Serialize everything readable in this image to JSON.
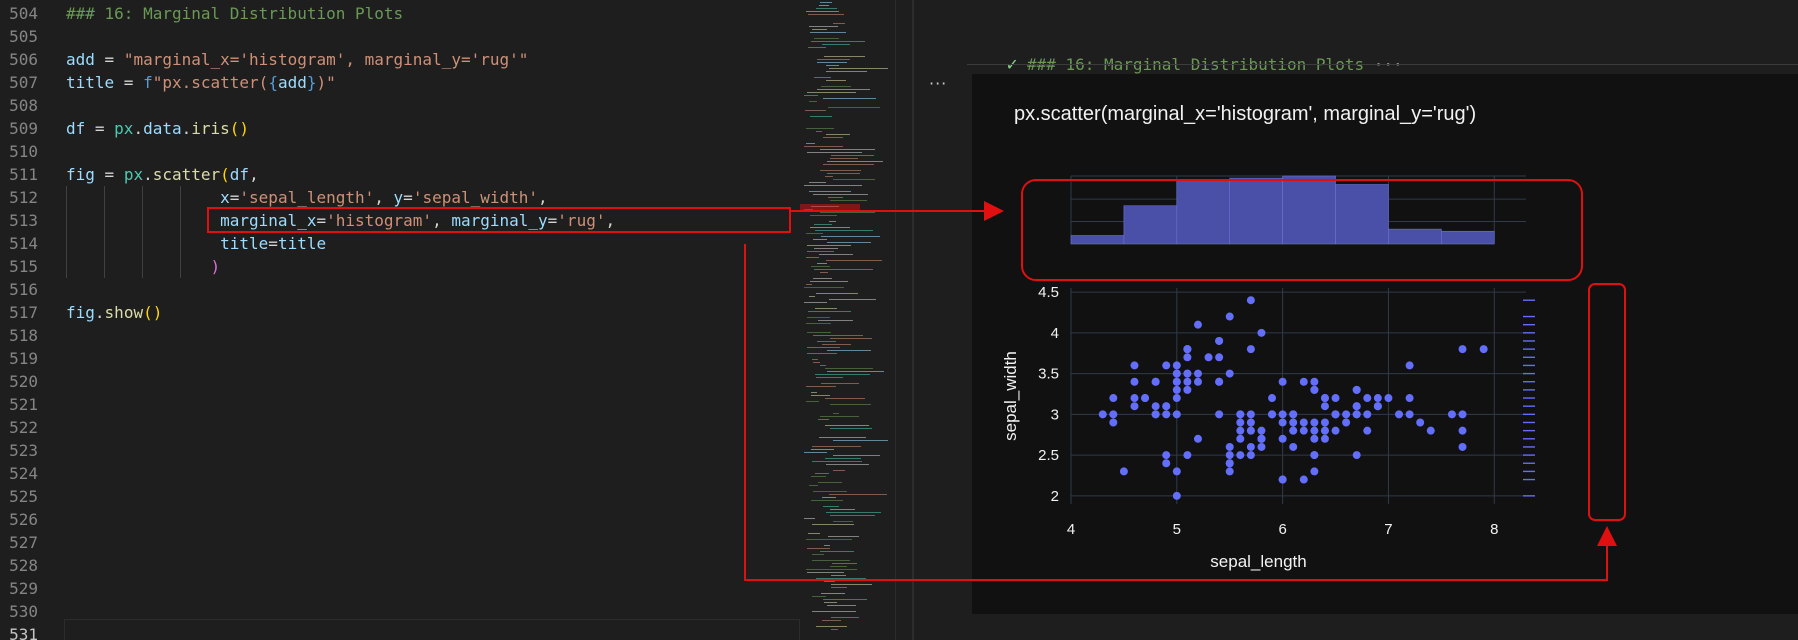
{
  "editor": {
    "lines": [
      {
        "num": "504",
        "tokens": [
          [
            "c",
            "### 16: Marginal Distribution Plots"
          ]
        ]
      },
      {
        "num": "505",
        "tokens": []
      },
      {
        "num": "506",
        "tokens": [
          [
            "v",
            "add"
          ],
          [
            "o",
            " = "
          ],
          [
            "s",
            "\"marginal_x='histogram', marginal_y='rug'\""
          ]
        ]
      },
      {
        "num": "507",
        "tokens": [
          [
            "v",
            "title"
          ],
          [
            "o",
            " = "
          ],
          [
            "f",
            "f"
          ],
          [
            "s",
            "\"px.scatter("
          ],
          [
            "f",
            "{"
          ],
          [
            "v",
            "add"
          ],
          [
            "f",
            "}"
          ],
          [
            "s",
            ")\""
          ]
        ]
      },
      {
        "num": "508",
        "tokens": []
      },
      {
        "num": "509",
        "tokens": [
          [
            "v",
            "df"
          ],
          [
            "o",
            " = "
          ],
          [
            "m",
            "px"
          ],
          [
            "o",
            "."
          ],
          [
            "v",
            "data"
          ],
          [
            "o",
            "."
          ],
          [
            "n",
            "iris"
          ],
          [
            "b",
            "()"
          ]
        ]
      },
      {
        "num": "510",
        "tokens": []
      },
      {
        "num": "511",
        "tokens": [
          [
            "v",
            "fig"
          ],
          [
            "o",
            " = "
          ],
          [
            "m",
            "px"
          ],
          [
            "o",
            "."
          ],
          [
            "n",
            "scatter"
          ],
          [
            "b",
            "("
          ],
          [
            "v",
            "df"
          ],
          [
            "o",
            ","
          ]
        ]
      },
      {
        "num": "512",
        "tokens": [
          [
            "o",
            "                "
          ],
          [
            "v",
            "x"
          ],
          [
            "o",
            "="
          ],
          [
            "s",
            "'sepal_length'"
          ],
          [
            "o",
            ", "
          ],
          [
            "v",
            "y"
          ],
          [
            "o",
            "="
          ],
          [
            "s",
            "'sepal_width'"
          ],
          [
            "o",
            ","
          ]
        ]
      },
      {
        "num": "513",
        "tokens": [
          [
            "o",
            "                "
          ],
          [
            "v",
            "marginal_x"
          ],
          [
            "o",
            "="
          ],
          [
            "s",
            "'histogram'"
          ],
          [
            "o",
            ", "
          ],
          [
            "v",
            "marginal_y"
          ],
          [
            "o",
            "="
          ],
          [
            "s",
            "'rug'"
          ],
          [
            "o",
            ","
          ]
        ]
      },
      {
        "num": "514",
        "tokens": [
          [
            "o",
            "                "
          ],
          [
            "v",
            "title"
          ],
          [
            "o",
            "="
          ],
          [
            "v",
            "title"
          ]
        ]
      },
      {
        "num": "515",
        "tokens": [
          [
            "o",
            "               "
          ],
          [
            "b",
            ")"
          ]
        ]
      },
      {
        "num": "516",
        "tokens": []
      },
      {
        "num": "517",
        "tokens": [
          [
            "v",
            "fig"
          ],
          [
            "o",
            "."
          ],
          [
            "n",
            "show"
          ],
          [
            "b",
            "()"
          ]
        ]
      },
      {
        "num": "518",
        "tokens": []
      },
      {
        "num": "519",
        "tokens": []
      },
      {
        "num": "520",
        "tokens": []
      },
      {
        "num": "521",
        "tokens": []
      },
      {
        "num": "522",
        "tokens": []
      },
      {
        "num": "523",
        "tokens": []
      },
      {
        "num": "524",
        "tokens": []
      },
      {
        "num": "525",
        "tokens": []
      },
      {
        "num": "526",
        "tokens": []
      },
      {
        "num": "527",
        "tokens": []
      },
      {
        "num": "528",
        "tokens": []
      },
      {
        "num": "529",
        "tokens": []
      },
      {
        "num": "530",
        "tokens": []
      },
      {
        "num": "531",
        "tokens": []
      }
    ],
    "active_line": "531"
  },
  "notebook": {
    "cell_header": "### 16: Marginal Distribution Plots",
    "cell_header_ellipsis": "···",
    "cell_menu": "···"
  },
  "chart_data": {
    "type": "scatter",
    "title": "px.scatter(marginal_x='histogram', marginal_y='rug')",
    "xlabel": "sepal_length",
    "ylabel": "sepal_width",
    "xlim": [
      4,
      8.3
    ],
    "ylim": [
      1.9,
      4.55
    ],
    "xticks": [
      "4",
      "5",
      "6",
      "7",
      "8"
    ],
    "yticks": [
      "2",
      "2.5",
      "3",
      "3.5",
      "4",
      "4.5"
    ],
    "marker_color": "#636efa",
    "points": [
      [
        5.1,
        3.5
      ],
      [
        4.9,
        3.0
      ],
      [
        4.7,
        3.2
      ],
      [
        4.6,
        3.1
      ],
      [
        5.0,
        3.6
      ],
      [
        5.4,
        3.9
      ],
      [
        4.6,
        3.4
      ],
      [
        5.0,
        3.4
      ],
      [
        4.4,
        2.9
      ],
      [
        4.9,
        3.1
      ],
      [
        5.4,
        3.7
      ],
      [
        4.8,
        3.4
      ],
      [
        4.8,
        3.0
      ],
      [
        4.3,
        3.0
      ],
      [
        5.8,
        4.0
      ],
      [
        5.7,
        4.4
      ],
      [
        5.4,
        3.9
      ],
      [
        5.1,
        3.5
      ],
      [
        5.7,
        3.8
      ],
      [
        5.1,
        3.8
      ],
      [
        5.4,
        3.4
      ],
      [
        5.1,
        3.7
      ],
      [
        4.6,
        3.6
      ],
      [
        5.1,
        3.3
      ],
      [
        4.8,
        3.4
      ],
      [
        5.0,
        3.0
      ],
      [
        5.0,
        3.4
      ],
      [
        5.2,
        3.5
      ],
      [
        5.2,
        3.4
      ],
      [
        4.7,
        3.2
      ],
      [
        4.8,
        3.1
      ],
      [
        5.4,
        3.4
      ],
      [
        5.2,
        4.1
      ],
      [
        5.5,
        4.2
      ],
      [
        4.9,
        3.1
      ],
      [
        5.0,
        3.2
      ],
      [
        5.5,
        3.5
      ],
      [
        4.9,
        3.6
      ],
      [
        4.4,
        3.0
      ],
      [
        5.1,
        3.4
      ],
      [
        5.0,
        3.5
      ],
      [
        4.5,
        2.3
      ],
      [
        4.4,
        3.2
      ],
      [
        5.0,
        3.5
      ],
      [
        5.1,
        3.8
      ],
      [
        4.8,
        3.0
      ],
      [
        5.1,
        3.8
      ],
      [
        4.6,
        3.2
      ],
      [
        5.3,
        3.7
      ],
      [
        5.0,
        3.3
      ],
      [
        7.0,
        3.2
      ],
      [
        6.4,
        3.2
      ],
      [
        6.9,
        3.1
      ],
      [
        5.5,
        2.3
      ],
      [
        6.5,
        2.8
      ],
      [
        5.7,
        2.8
      ],
      [
        6.3,
        3.3
      ],
      [
        4.9,
        2.4
      ],
      [
        6.6,
        2.9
      ],
      [
        5.2,
        2.7
      ],
      [
        5.0,
        2.0
      ],
      [
        5.9,
        3.0
      ],
      [
        6.0,
        2.2
      ],
      [
        6.1,
        2.9
      ],
      [
        5.6,
        2.9
      ],
      [
        6.7,
        3.1
      ],
      [
        5.6,
        3.0
      ],
      [
        5.8,
        2.7
      ],
      [
        6.2,
        2.2
      ],
      [
        5.6,
        2.5
      ],
      [
        5.9,
        3.2
      ],
      [
        6.1,
        2.8
      ],
      [
        6.3,
        2.5
      ],
      [
        6.1,
        2.8
      ],
      [
        6.4,
        2.9
      ],
      [
        6.6,
        3.0
      ],
      [
        6.8,
        2.8
      ],
      [
        6.7,
        3.0
      ],
      [
        6.0,
        2.9
      ],
      [
        5.7,
        2.6
      ],
      [
        5.5,
        2.4
      ],
      [
        5.5,
        2.4
      ],
      [
        5.8,
        2.7
      ],
      [
        6.0,
        2.7
      ],
      [
        5.4,
        3.0
      ],
      [
        6.0,
        3.4
      ],
      [
        6.7,
        3.1
      ],
      [
        6.3,
        2.3
      ],
      [
        5.6,
        3.0
      ],
      [
        5.5,
        2.5
      ],
      [
        5.5,
        2.6
      ],
      [
        6.1,
        3.0
      ],
      [
        5.8,
        2.6
      ],
      [
        5.0,
        2.3
      ],
      [
        5.6,
        2.7
      ],
      [
        5.7,
        3.0
      ],
      [
        5.7,
        2.9
      ],
      [
        6.2,
        2.9
      ],
      [
        5.1,
        2.5
      ],
      [
        5.7,
        2.8
      ],
      [
        6.3,
        3.3
      ],
      [
        5.8,
        2.7
      ],
      [
        7.1,
        3.0
      ],
      [
        6.3,
        2.9
      ],
      [
        6.5,
        3.0
      ],
      [
        7.6,
        3.0
      ],
      [
        4.9,
        2.5
      ],
      [
        7.3,
        2.9
      ],
      [
        6.7,
        2.5
      ],
      [
        7.2,
        3.6
      ],
      [
        6.5,
        3.2
      ],
      [
        6.4,
        2.7
      ],
      [
        6.8,
        3.0
      ],
      [
        5.7,
        2.5
      ],
      [
        5.8,
        2.8
      ],
      [
        6.4,
        3.2
      ],
      [
        6.5,
        3.0
      ],
      [
        7.7,
        3.8
      ],
      [
        7.7,
        2.6
      ],
      [
        6.0,
        2.2
      ],
      [
        6.9,
        3.2
      ],
      [
        5.6,
        2.8
      ],
      [
        7.7,
        2.8
      ],
      [
        6.3,
        2.7
      ],
      [
        6.7,
        3.3
      ],
      [
        7.2,
        3.2
      ],
      [
        6.2,
        2.8
      ],
      [
        6.1,
        3.0
      ],
      [
        6.4,
        2.8
      ],
      [
        7.2,
        3.0
      ],
      [
        7.4,
        2.8
      ],
      [
        7.9,
        3.8
      ],
      [
        6.4,
        2.8
      ],
      [
        6.3,
        2.8
      ],
      [
        6.1,
        2.6
      ],
      [
        7.7,
        3.0
      ],
      [
        6.3,
        3.4
      ],
      [
        6.4,
        3.1
      ],
      [
        6.0,
        3.0
      ],
      [
        6.9,
        3.1
      ],
      [
        6.7,
        3.1
      ],
      [
        6.9,
        3.1
      ],
      [
        5.8,
        2.7
      ],
      [
        6.8,
        3.2
      ],
      [
        6.7,
        3.3
      ],
      [
        6.7,
        3.0
      ],
      [
        6.3,
        2.5
      ],
      [
        6.5,
        3.0
      ],
      [
        6.2,
        3.4
      ],
      [
        5.9,
        3.0
      ]
    ],
    "histogram": {
      "bin_edges": [
        4,
        4.5,
        5,
        5.5,
        6,
        6.5,
        7,
        7.5,
        8
      ],
      "counts": [
        4,
        18,
        30,
        31,
        32,
        28,
        7,
        6
      ]
    },
    "rug_y": [
      2.0,
      2.2,
      2.3,
      2.4,
      2.5,
      2.6,
      2.7,
      2.8,
      2.9,
      3.0,
      3.1,
      3.2,
      3.3,
      3.4,
      3.5,
      3.6,
      3.7,
      3.8,
      3.9,
      4.0,
      4.1,
      4.2,
      4.4
    ]
  },
  "colors": {
    "annotation": "#e01010",
    "plot_bg": "#111111",
    "grid": "#2f3b4a",
    "histogram_fill": "#4a4fa8"
  }
}
